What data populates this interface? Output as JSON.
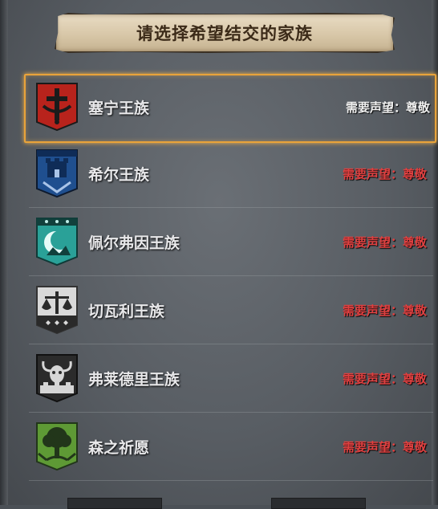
{
  "title": "请选择希望结交的家族",
  "clans": [
    {
      "name": "塞宁王族",
      "requirement": "需要声望：尊敬",
      "met": true,
      "crest_color": "#b8231c",
      "crest_icon": "sword-icon"
    },
    {
      "name": "希尔王族",
      "requirement": "需要声望：尊敬",
      "met": false,
      "crest_color": "#1f4f8f",
      "crest_icon": "castle-icon"
    },
    {
      "name": "佩尔弗因王族",
      "requirement": "需要声望：尊敬",
      "met": false,
      "crest_color": "#2aa198",
      "crest_icon": "moon-icon"
    },
    {
      "name": "切瓦利王族",
      "requirement": "需要声望：尊敬",
      "met": false,
      "crest_color": "#d9d9d9",
      "crest_icon": "scales-icon"
    },
    {
      "name": "弗莱德里王族",
      "requirement": "需要声望：尊敬",
      "met": false,
      "crest_color": "#2b2b2b",
      "crest_icon": "bull-icon"
    },
    {
      "name": "森之祈愿",
      "requirement": "需要声望：尊敬",
      "met": false,
      "crest_color": "#5e9a35",
      "crest_icon": "tree-icon"
    }
  ]
}
